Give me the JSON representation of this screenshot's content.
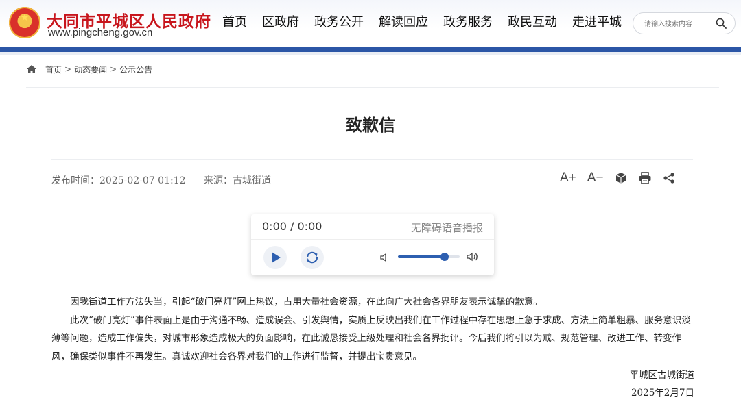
{
  "header": {
    "site_name": "大同市平城区人民政府",
    "site_url": "www.pingcheng.gov.cn",
    "nav": [
      "首页",
      "区政府",
      "政务公开",
      "解读回应",
      "政务服务",
      "政民互动",
      "走进平城"
    ],
    "search_placeholder": "请输入搜索内容"
  },
  "breadcrumb": [
    "首页",
    "动态要闻",
    "公示公告"
  ],
  "article": {
    "title": "致歉信",
    "publish_time": "发布时间：2025-02-07 01:12",
    "source": "来源：古城街道",
    "paragraphs": [
      "因我街道工作方法失当，引起“破门亮灯”网上热议，占用大量社会资源，在此向广大社会各界朋友表示诚挚的歉意。",
      "此次“破门亮灯”事件表面上是由于沟通不畅、造成误会、引发舆情，实质上反映出我们在工作过程中存在思想上急于求成、方法上简单粗暴、服务意识淡薄等问题，造成工作偏失，对城市形象造成极大的负面影响，在此诚恳接受上级处理和社会各界批评。今后我们将引以为戒、规范管理、改进工作、转变作风，确保类似事件不再发生。真诚欢迎社会各界对我们的工作进行监督，并提出宝贵意见。"
    ],
    "signature_org": "平城区古城街道",
    "signature_date": "2025年2月7日"
  },
  "tools": {
    "font_increase": "A+",
    "font_decrease": "A−"
  },
  "player": {
    "time": "0:00 / 0:00",
    "label": "无障碍语音播报",
    "volume": 0.75
  },
  "colors": {
    "brand_red": "#c8161d",
    "brand_blue": "#2b56a6"
  }
}
